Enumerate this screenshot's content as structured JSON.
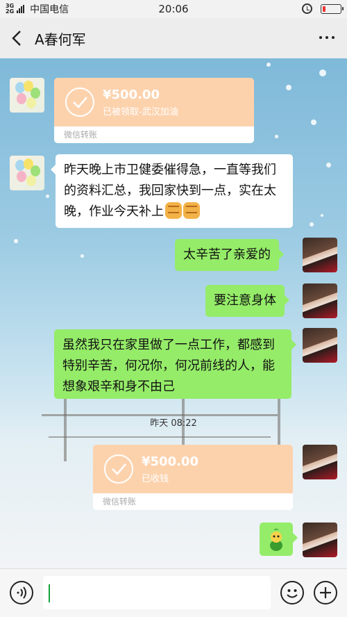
{
  "status_bar": {
    "network_top": "3G",
    "network_bottom": "2G",
    "carrier": "中国电信",
    "time": "20:06"
  },
  "header": {
    "title": "A春何军"
  },
  "messages": {
    "transfer_1": {
      "amount": "¥500.00",
      "status": "已被领取-武汉加油",
      "footer": "微信转账"
    },
    "text_1": "昨天晚上市卫健委催得急，一直等我们的资料汇总，我回家快到一点，实在太晚，作业今天补上",
    "text_2": "太辛苦了亲爱的",
    "text_3": "要注意身体",
    "text_4": "虽然我只在家里做了一点工作，都感到特别辛苦，何况你，何况前线的人，能想象艰辛和身不由己",
    "timestamp": "昨天 08:22",
    "transfer_2": {
      "amount": "¥500.00",
      "status": "已收钱",
      "footer": "微信转账"
    }
  },
  "colors": {
    "green_bubble": "#95ec69",
    "transfer_orange": "#fcd2ad",
    "battery_low": "#e33"
  },
  "icons": [
    "back-icon",
    "more-icon",
    "alarm-icon",
    "battery-icon",
    "check-icon",
    "voice-icon",
    "emoji-icon",
    "plus-icon"
  ]
}
